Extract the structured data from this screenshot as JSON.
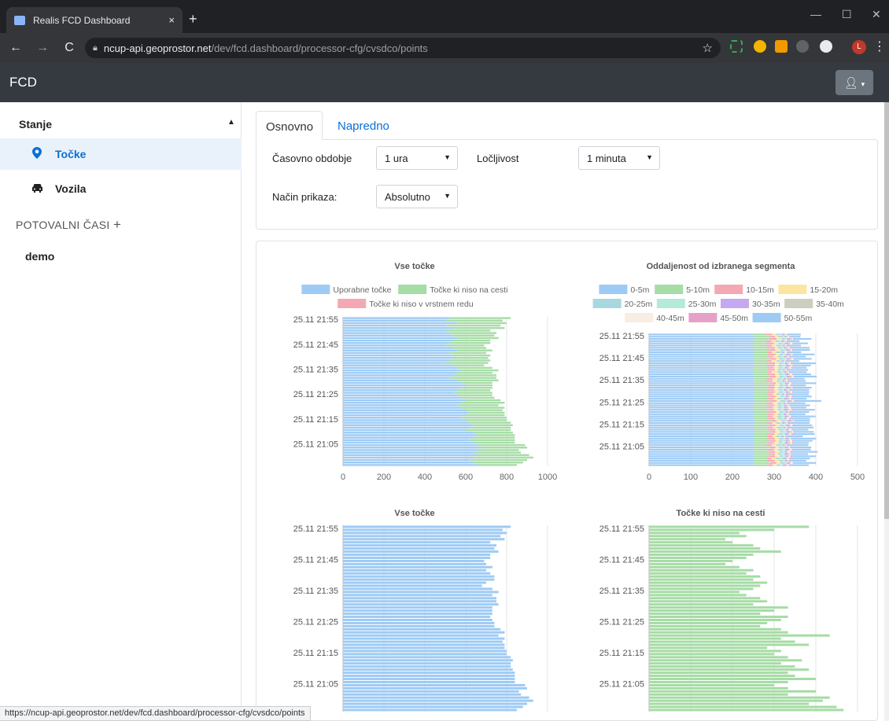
{
  "browser": {
    "tab_title": "Realis FCD Dashboard",
    "tab_close": "×",
    "new_tab": "+",
    "url_host": "ncup-api.geoprostor.net",
    "url_path": "/dev/fcd.dashboard/processor-cfg/cvsdco/points",
    "profile_initial": "L",
    "status_url": "https://ncup-api.geoprostor.net/dev/fcd.dashboard/processor-cfg/cvsdco/points"
  },
  "app": {
    "brand": "FCD"
  },
  "sidebar": {
    "section": "Stanje",
    "items": [
      {
        "label": "Točke",
        "active": true,
        "icon": "map-marker-icon"
      },
      {
        "label": "Vozila",
        "active": false,
        "icon": "car-icon"
      }
    ],
    "travel_times": "POTOVALNI ČASI",
    "travel_items": [
      "demo"
    ]
  },
  "tabs": [
    "Osnovno",
    "Napredno"
  ],
  "form": {
    "period_label": "Časovno obdobje",
    "period_value": "1 ura",
    "resolution_label": "Ločljivost",
    "resolution_value": "1 minuta",
    "mode_label": "Način prikaza:",
    "mode_value": "Absolutno"
  },
  "colors": {
    "blue": "#9ecbf5",
    "green": "#a6dca6",
    "pink": "#f4a8b4",
    "accent": "#0a6fd8"
  },
  "chart_data": [
    {
      "type": "bar",
      "orientation": "horizontal",
      "stacked": true,
      "title": "Vse točke",
      "legend": [
        "Uporabne točke",
        "Točke ki niso na cesti",
        "Točke ki niso v vrstnem redu"
      ],
      "y_ticks": [
        "25.11 21:55",
        "25.11 21:45",
        "25.11 21:35",
        "25.11 21:25",
        "25.11 21:15",
        "25.11 21:05"
      ],
      "xlim": [
        0,
        1000
      ],
      "x_ticks": [
        0,
        200,
        400,
        600,
        800,
        1000
      ],
      "series": [
        {
          "name": "Uporabne točke",
          "values": [
            520,
            500,
            560,
            510,
            540,
            500,
            520,
            530,
            560,
            540,
            520,
            500,
            540,
            560,
            520,
            530,
            550,
            520,
            500,
            540,
            560,
            580,
            560,
            540,
            520,
            560,
            580,
            600,
            580,
            560,
            540,
            560,
            580,
            600,
            580,
            560,
            580,
            600,
            620,
            600,
            580,
            600,
            620,
            640,
            620,
            600,
            640,
            660,
            640,
            620,
            640,
            660,
            680,
            660,
            640,
            660,
            640,
            620,
            640,
            660
          ]
        },
        {
          "name": "Točke ki niso na cesti",
          "values": [
            300,
            280,
            240,
            260,
            250,
            220,
            230,
            210,
            200,
            180,
            200,
            190,
            160,
            170,
            180,
            190,
            160,
            200,
            210,
            150,
            170,
            180,
            170,
            210,
            230,
            200,
            150,
            130,
            150,
            160,
            190,
            170,
            160,
            170,
            210,
            200,
            210,
            180,
            170,
            190,
            220,
            200,
            200,
            190,
            200,
            220,
            190,
            180,
            200,
            220,
            200,
            230,
            220,
            200,
            230,
            250,
            290,
            280,
            240,
            190
          ]
        }
      ]
    },
    {
      "type": "bar",
      "orientation": "horizontal",
      "stacked": true,
      "title": "Oddaljenost od izbranega segmenta",
      "legend": [
        "0-5m",
        "5-10m",
        "10-15m",
        "15-20m",
        "20-25m",
        "25-30m",
        "30-35m",
        "35-40m",
        "40-45m",
        "45-50m",
        "50-55m"
      ],
      "y_ticks": [
        "25.11 21:55",
        "25.11 21:45",
        "25.11 21:35",
        "25.11 21:25",
        "25.11 21:15",
        "25.11 21:05"
      ],
      "xlim": [
        0,
        500
      ],
      "x_ticks": [
        0,
        100,
        200,
        300,
        400,
        500
      ],
      "series": [
        {
          "name": "0-5m",
          "values": [
            250,
            255,
            248,
            252,
            250,
            246,
            253,
            250,
            248,
            255,
            250,
            252,
            249,
            251,
            254,
            250,
            247,
            252,
            250,
            253,
            251,
            249,
            252,
            250,
            255,
            251,
            249,
            253,
            250,
            252,
            254,
            250,
            248,
            251,
            253,
            250,
            252,
            249,
            251,
            255,
            250,
            252,
            250,
            254,
            251,
            249,
            253,
            250,
            252,
            251,
            249,
            253,
            250,
            252,
            254,
            250,
            251,
            249,
            253,
            250
          ]
        },
        {
          "name": "5-10m",
          "values": [
            30,
            35,
            40,
            28,
            33,
            36,
            31,
            38,
            35,
            30,
            34,
            37,
            32,
            36,
            30,
            35,
            38,
            31,
            34,
            36,
            33,
            30,
            38,
            35,
            31,
            36,
            34,
            30,
            37,
            33,
            35,
            32,
            38,
            30,
            34,
            36,
            31,
            35,
            33,
            37,
            30,
            36,
            34,
            32,
            38,
            35,
            31,
            33,
            36,
            34,
            30,
            37,
            32,
            35,
            33,
            36,
            31,
            34,
            37,
            33
          ]
        },
        {
          "name": "10-15m",
          "values": [
            15,
            12,
            18,
            14,
            16,
            13,
            17,
            15,
            12,
            18,
            14,
            16,
            13,
            15,
            17,
            14,
            16,
            12,
            18,
            15,
            13,
            17,
            14,
            16,
            15,
            12,
            18,
            14,
            16,
            13,
            17,
            15,
            14,
            16,
            12,
            18,
            15,
            13,
            17,
            14,
            16,
            15,
            13,
            17,
            14,
            16,
            12,
            18,
            15,
            14,
            16,
            13,
            17,
            15,
            14,
            16,
            12,
            18,
            15,
            14
          ]
        },
        {
          "name": "15-20m",
          "values": [
            10,
            8,
            12,
            9,
            11,
            10,
            8,
            12,
            9,
            10,
            11,
            8,
            12,
            10,
            9,
            11,
            8,
            12,
            10,
            9,
            11,
            10,
            8,
            12,
            9,
            11,
            10,
            8,
            12,
            10,
            9,
            11,
            8,
            12,
            10,
            9,
            11,
            10,
            8,
            12,
            9,
            11,
            10,
            8,
            12,
            10,
            9,
            11,
            8,
            12,
            10,
            9,
            11,
            10,
            8,
            12,
            9,
            11,
            10,
            9
          ]
        },
        {
          "name": "20-25m",
          "values": [
            8,
            10,
            7,
            9,
            8,
            11,
            9,
            7,
            10,
            8,
            9,
            11,
            7,
            8,
            10,
            9,
            7,
            11,
            8,
            9,
            10,
            8,
            7,
            9,
            11,
            8,
            10,
            9,
            7,
            8,
            11,
            9,
            10,
            8,
            7,
            9,
            8,
            11,
            10,
            7,
            9,
            8,
            10,
            11,
            7,
            9,
            8,
            10,
            9,
            7,
            11,
            8,
            10,
            9,
            8,
            7,
            11,
            9,
            10,
            8
          ]
        },
        {
          "name": "25-30m",
          "values": [
            6,
            5,
            7,
            6,
            8,
            5,
            6,
            7,
            5,
            8,
            6,
            7,
            5,
            6,
            8,
            7,
            5,
            6,
            7,
            8,
            5,
            6,
            7,
            5,
            8,
            6,
            7,
            5,
            6,
            8,
            7,
            5,
            6,
            7,
            8,
            5,
            6,
            7,
            5,
            8,
            6,
            7,
            5,
            6,
            8,
            7,
            5,
            6,
            7,
            8,
            5,
            6,
            7,
            5,
            8,
            6,
            7,
            5,
            6,
            7
          ]
        },
        {
          "name": "30-35m",
          "values": [
            5,
            4,
            6,
            5,
            7,
            4,
            5,
            6,
            4,
            7,
            5,
            6,
            4,
            5,
            7,
            6,
            4,
            5,
            6,
            7,
            4,
            5,
            6,
            4,
            7,
            5,
            6,
            4,
            5,
            7,
            6,
            4,
            5,
            6,
            7,
            4,
            5,
            6,
            4,
            7,
            5,
            6,
            4,
            5,
            7,
            6,
            4,
            5,
            6,
            7,
            4,
            5,
            6,
            4,
            7,
            5,
            6,
            4,
            5,
            6
          ]
        },
        {
          "name": "35-40m",
          "values": [
            4,
            3,
            5,
            4,
            6,
            3,
            4,
            5,
            3,
            6,
            4,
            5,
            3,
            4,
            6,
            5,
            3,
            4,
            5,
            6,
            3,
            4,
            5,
            3,
            6,
            4,
            5,
            3,
            4,
            6,
            5,
            3,
            4,
            5,
            6,
            3,
            4,
            5,
            3,
            6,
            4,
            5,
            3,
            4,
            6,
            5,
            3,
            4,
            5,
            6,
            3,
            4,
            5,
            3,
            6,
            4,
            5,
            3,
            4,
            5
          ]
        },
        {
          "name": "40-45m",
          "values": [
            3,
            4,
            2,
            3,
            5,
            2,
            4,
            3,
            5,
            2,
            3,
            4,
            2,
            5,
            3,
            4,
            2,
            3,
            5,
            4,
            2,
            3,
            4,
            5,
            2,
            3,
            4,
            2,
            5,
            3,
            4,
            2,
            3,
            5,
            4,
            2,
            3,
            4,
            5,
            2,
            3,
            4,
            2,
            5,
            3,
            4,
            2,
            3,
            5,
            4,
            2,
            3,
            4,
            5,
            2,
            3,
            4,
            2,
            5,
            3
          ]
        },
        {
          "name": "45-50m",
          "values": [
            3,
            2,
            4,
            3,
            2,
            4,
            3,
            5,
            2,
            3,
            4,
            2,
            3,
            5,
            4,
            2,
            3,
            4,
            2,
            3,
            5,
            4,
            2,
            3,
            4,
            2,
            3,
            5,
            4,
            2,
            3,
            4,
            2,
            3,
            5,
            4,
            2,
            3,
            4,
            2,
            3,
            5,
            4,
            2,
            3,
            4,
            2,
            3,
            5,
            4,
            2,
            3,
            4,
            2,
            3,
            5,
            4,
            2,
            3,
            4
          ]
        },
        {
          "name": "50-55m",
          "values": [
            30,
            25,
            40,
            28,
            35,
            30,
            45,
            38,
            32,
            50,
            36,
            42,
            30,
            55,
            40,
            35,
            48,
            38,
            44,
            52,
            36,
            40,
            58,
            34,
            42,
            46,
            38,
            50,
            44,
            36,
            62,
            40,
            48,
            34,
            52,
            44,
            38,
            56,
            46,
            36,
            50,
            42,
            60,
            38,
            46,
            52,
            40,
            58,
            44,
            36,
            50,
            48,
            42,
            64,
            38,
            56,
            46,
            40,
            52,
            44
          ]
        }
      ]
    },
    {
      "type": "bar",
      "orientation": "horizontal",
      "title": "Vse točke",
      "y_ticks": [
        "25.11 21:55",
        "25.11 21:45",
        "25.11 21:35",
        "25.11 21:25",
        "25.11 21:15",
        "25.11 21:05"
      ],
      "xlim": [
        0,
        1000
      ],
      "series": [
        {
          "name": "Vse točke",
          "values": [
            820,
            780,
            800,
            770,
            790,
            720,
            750,
            740,
            760,
            720,
            720,
            690,
            700,
            730,
            700,
            720,
            740,
            740,
            700,
            680,
            730,
            760,
            730,
            750,
            750,
            760,
            730,
            730,
            730,
            720,
            730,
            740,
            740,
            770,
            790,
            760,
            790,
            780,
            790,
            790,
            800,
            800,
            820,
            830,
            820,
            820,
            830,
            840,
            840,
            840,
            840,
            890,
            900,
            860,
            870,
            910,
            930,
            900,
            880,
            850
          ]
        }
      ]
    },
    {
      "type": "bar",
      "orientation": "horizontal",
      "title": "Točke ki niso na cesti",
      "y_ticks": [
        "25.11 21:55",
        "25.11 21:45",
        "25.11 21:35",
        "25.11 21:25",
        "25.11 21:15",
        "25.11 21:05"
      ],
      "xlim": [
        0,
        300
      ],
      "series": [
        {
          "name": "Točke ki niso na cesti",
          "values": [
            230,
            180,
            130,
            140,
            110,
            120,
            150,
            160,
            190,
            150,
            140,
            120,
            110,
            130,
            150,
            140,
            160,
            150,
            170,
            160,
            150,
            130,
            140,
            160,
            170,
            150,
            200,
            180,
            160,
            200,
            190,
            170,
            160,
            190,
            200,
            260,
            190,
            210,
            230,
            170,
            190,
            180,
            200,
            220,
            190,
            210,
            230,
            200,
            210,
            240,
            200,
            180,
            200,
            240,
            200,
            260,
            250,
            230,
            270,
            280
          ]
        }
      ]
    }
  ]
}
